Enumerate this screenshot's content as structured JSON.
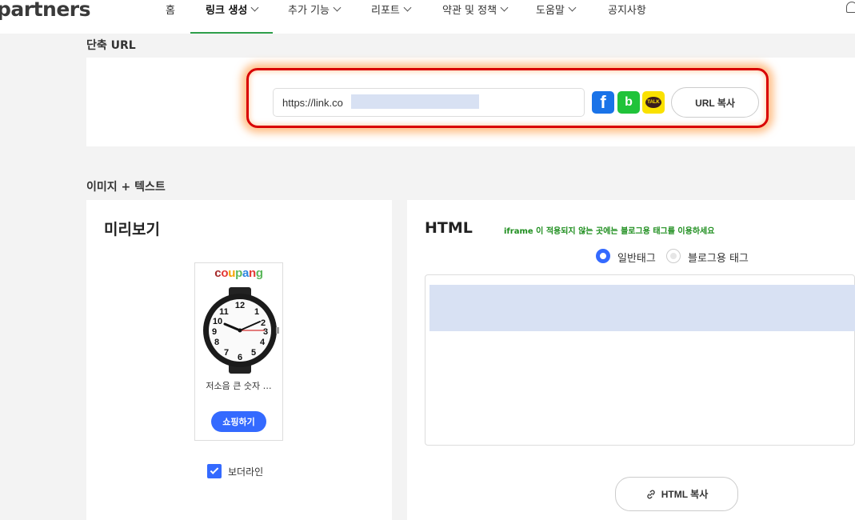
{
  "header": {
    "logo": "partners",
    "logo_mark": "~~~",
    "nav": [
      {
        "label": "홈",
        "active": false,
        "dropdown": false
      },
      {
        "label": "링크 생성",
        "active": true,
        "dropdown": true
      },
      {
        "label": "추가 기능",
        "active": false,
        "dropdown": true
      },
      {
        "label": "리포트",
        "active": false,
        "dropdown": true
      },
      {
        "label": "약관 및 정책",
        "active": false,
        "dropdown": true
      },
      {
        "label": "도움말",
        "active": false,
        "dropdown": true
      },
      {
        "label": "공지사항",
        "active": false,
        "dropdown": false
      }
    ],
    "accent_color": "#2e9e4a"
  },
  "short_url": {
    "section_title": "단축 URL",
    "url_value": "https://link.co",
    "share_icons": [
      "facebook-icon",
      "band-icon",
      "kakaotalk-icon"
    ],
    "kakao_text": "TALK",
    "copy_label": "URL 복사"
  },
  "image_text": {
    "section_title": "이미지 + 텍스트",
    "preview": {
      "heading": "미리보기",
      "brand": [
        "c",
        "o",
        "u",
        "p",
        "a",
        "n",
        "g"
      ],
      "product_name": "저소음 큰 숫자 …",
      "shop_button": "쇼핑하기",
      "border_checked": true,
      "border_label": "보더라인"
    },
    "html": {
      "heading": "HTML",
      "hint": "iframe 이 적용되지 않는 곳에는 블로그용 태그를 이용하세요",
      "tag_options": [
        {
          "label": "일반태그",
          "selected": true
        },
        {
          "label": "블로그용 태그",
          "selected": false
        }
      ],
      "copy_label": "HTML 복사"
    }
  },
  "colors": {
    "primary": "#346aff",
    "highlight_border": "#d90000",
    "hint_text": "#1e8e1e"
  }
}
